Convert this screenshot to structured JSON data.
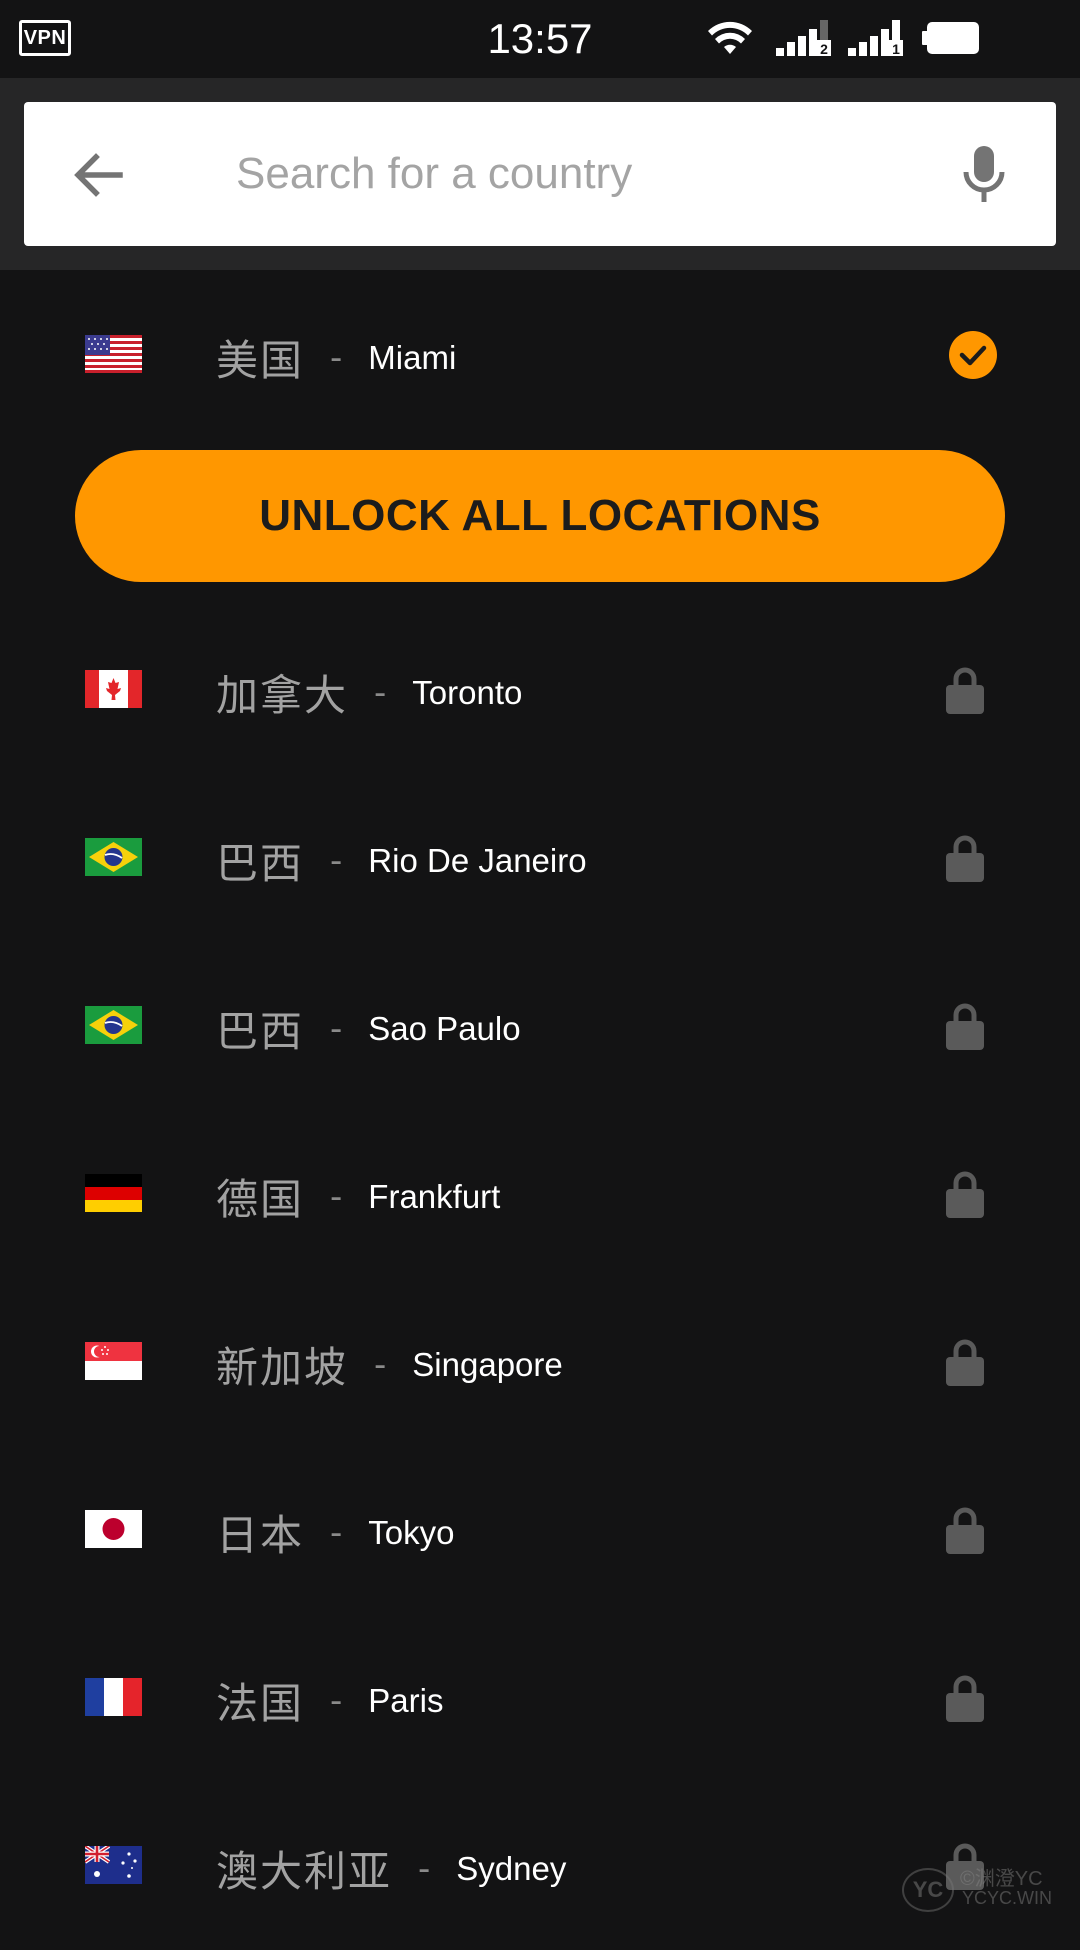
{
  "status_bar": {
    "vpn_badge": "VPN",
    "time": "13:57",
    "sim1_label": "2",
    "sim2_label": "1",
    "icons": [
      "wifi-icon",
      "signal-icon",
      "signal-icon",
      "battery-icon"
    ]
  },
  "search": {
    "placeholder": "Search for a country",
    "value": "",
    "back_icon": "back-arrow-icon",
    "mic_icon": "microphone-icon"
  },
  "selected_location": {
    "country": "美国",
    "separator": "-",
    "city": "Miami",
    "flag": "flag-us",
    "status_icon": "checkmark-icon"
  },
  "unlock_button": {
    "label": "UNLOCK ALL LOCATIONS"
  },
  "locations": [
    {
      "country": "加拿大",
      "separator": "-",
      "city": "Toronto",
      "flag": "flag-ca",
      "status_icon": "lock-icon"
    },
    {
      "country": "巴西",
      "separator": "-",
      "city": "Rio De Janeiro",
      "flag": "flag-br",
      "status_icon": "lock-icon"
    },
    {
      "country": "巴西",
      "separator": "-",
      "city": "Sao Paulo",
      "flag": "flag-br",
      "status_icon": "lock-icon"
    },
    {
      "country": "德国",
      "separator": "-",
      "city": "Frankfurt",
      "flag": "flag-de",
      "status_icon": "lock-icon"
    },
    {
      "country": "新加坡",
      "separator": "-",
      "city": "Singapore",
      "flag": "flag-sg",
      "status_icon": "lock-icon"
    },
    {
      "country": "日本",
      "separator": "-",
      "city": "Tokyo",
      "flag": "flag-jp",
      "status_icon": "lock-icon"
    },
    {
      "country": "法国",
      "separator": "-",
      "city": "Paris",
      "flag": "flag-fr",
      "status_icon": "lock-icon"
    },
    {
      "country": "澳大利亚",
      "separator": "-",
      "city": "Sydney",
      "flag": "flag-au",
      "status_icon": "lock-icon"
    }
  ],
  "watermark": {
    "logo": "YC",
    "line1": "©渊澄YC",
    "line2": "YCYC.WIN"
  },
  "colors": {
    "background": "#131314",
    "search_bar_bg": "#262627",
    "accent": "#ff9700",
    "lock_gray": "#5a5a5a",
    "country_gray": "#a2a2a2",
    "city_white": "#ffffff"
  }
}
